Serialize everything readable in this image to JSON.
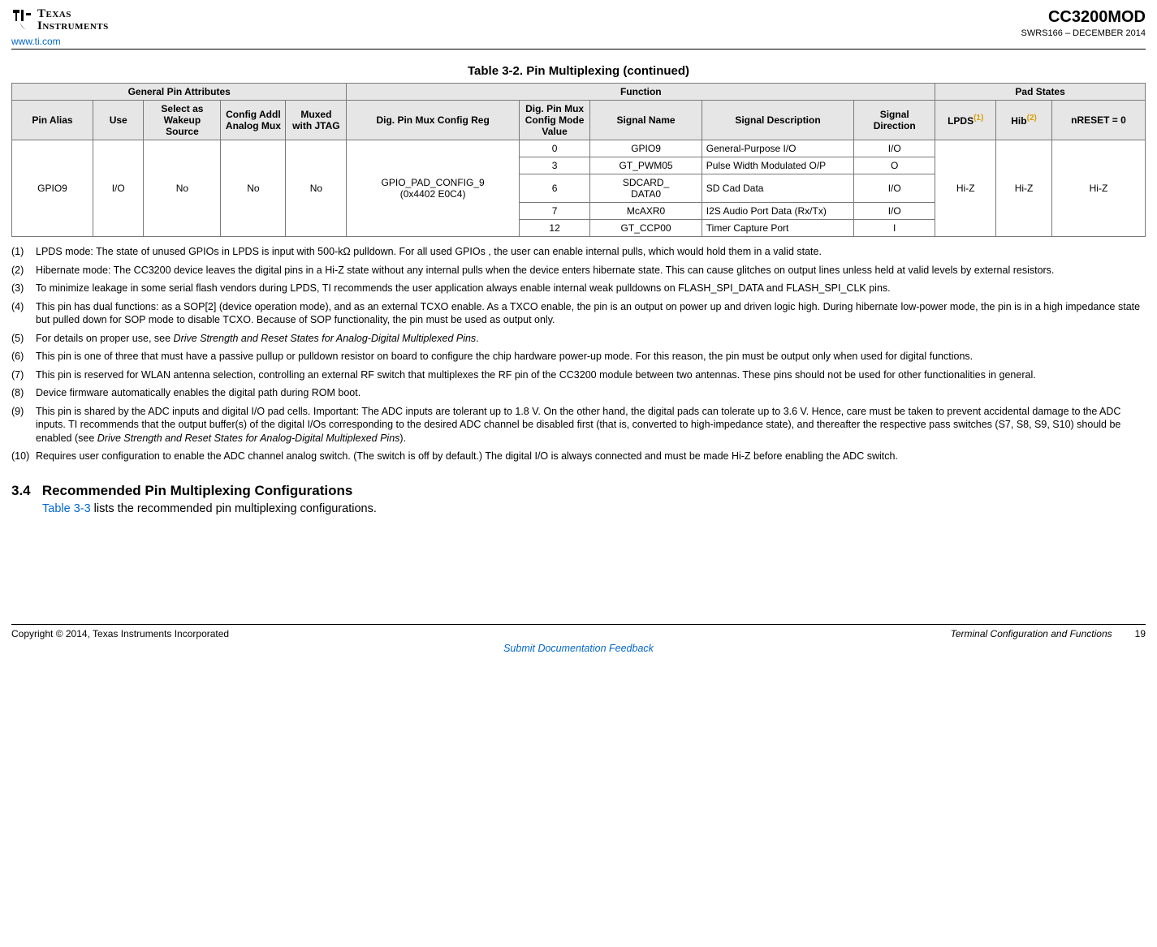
{
  "header": {
    "logo_line1": "Texas",
    "logo_line2": "Instruments",
    "product_code": "CC3200MOD",
    "doc_id": "SWRS166 – DECEMBER 2014",
    "site_url": "www.ti.com"
  },
  "table": {
    "caption": "Table 3-2. Pin Multiplexing (continued)",
    "group_headers": {
      "general": "General Pin Attributes",
      "function": "Function",
      "pad_states": "Pad States"
    },
    "col_headers": {
      "pin_alias": "Pin Alias",
      "use": "Use",
      "select_wakeup": "Select as Wakeup Source",
      "config_analog": "Config Addl Analog Mux",
      "muxed_jtag": "Muxed with JTAG",
      "dig_reg": "Dig. Pin Mux Config Reg",
      "dig_mode_val": "Dig. Pin Mux Config Mode Value",
      "signal_name": "Signal Name",
      "signal_desc": "Signal Description",
      "signal_dir": "Signal Direction",
      "lpds_label": "LPDS",
      "lpds_ref": "(1)",
      "hib_label": "Hib",
      "hib_ref": "(2)",
      "nreset": "nRESET = 0"
    },
    "shared": {
      "pin_alias": "GPIO9",
      "use": "I/O",
      "select_wakeup": "No",
      "config_analog": "No",
      "muxed_jtag": "No",
      "dig_reg_line1": "GPIO_PAD_CONFIG_9",
      "dig_reg_line2": "(0x4402 E0C4)",
      "lpds": "Hi-Z",
      "hib": "Hi-Z",
      "nreset": "Hi-Z"
    },
    "rows": [
      {
        "mode": "0",
        "name": "GPIO9",
        "name2": "",
        "desc": "General-Purpose I/O",
        "dir": "I/O"
      },
      {
        "mode": "3",
        "name": "GT_PWM05",
        "name2": "",
        "desc": "Pulse Width Modulated O/P",
        "dir": "O"
      },
      {
        "mode": "6",
        "name": "SDCARD_",
        "name2": "DATA0",
        "desc": "SD Cad Data",
        "dir": "I/O"
      },
      {
        "mode": "7",
        "name": "McAXR0",
        "name2": "",
        "desc": "I2S Audio Port Data (Rx/Tx)",
        "dir": "I/O"
      },
      {
        "mode": "12",
        "name": "GT_CCP00",
        "name2": "",
        "desc": "Timer Capture Port",
        "dir": "I"
      }
    ]
  },
  "notes": [
    {
      "n": "(1)",
      "text": "LPDS mode: The state of unused GPIOs in LPDS is input with 500-kΩ pulldown. For all used GPIOs , the user can enable internal pulls, which would hold them in a valid state."
    },
    {
      "n": "(2)",
      "text": "Hibernate mode: The CC3200 device leaves the digital pins in a Hi-Z state without any internal pulls when the device enters hibernate state. This can cause glitches on output lines unless held at valid levels by external resistors."
    },
    {
      "n": "(3)",
      "text": "To minimize leakage in some serial flash vendors during LPDS, TI recommends the user application always enable internal weak pulldowns on FLASH_SPI_DATA and FLASH_SPI_CLK pins."
    },
    {
      "n": "(4)",
      "text": "This pin has dual functions: as a SOP[2] (device operation mode), and as an external TCXO enable. As a TXCO enable, the pin is an output on power up and driven logic high. During hibernate low-power mode, the pin is in a high impedance state but pulled down for SOP mode to disable TCXO. Because of SOP functionality, the pin must be used as output only."
    },
    {
      "n": "(5)",
      "text_pre": "For details on proper use, see ",
      "em": "Drive Strength and Reset States for Analog-Digital Multiplexed Pins",
      "text_post": "."
    },
    {
      "n": "(6)",
      "text": "This pin is one of three that must have a passive pullup or pulldown resistor on board to configure the chip hardware power-up mode. For this reason, the pin must be output only when used for digital functions."
    },
    {
      "n": "(7)",
      "text": "This pin is reserved for WLAN antenna selection, controlling an external RF switch that multiplexes the RF pin of the CC3200 module between two antennas. These pins should not be used for other functionalities in general."
    },
    {
      "n": "(8)",
      "text": "Device firmware automatically enables the digital path during ROM boot."
    },
    {
      "n": "(9)",
      "text_pre": "This pin is shared by the ADC inputs and digital I/O pad cells. Important: The ADC inputs are tolerant up to 1.8 V. On the other hand, the digital pads can tolerate up to 3.6 V. Hence, care must be taken to prevent accidental damage to the ADC inputs. TI recommends that the output buffer(s) of the digital I/Os corresponding to the desired ADC channel be disabled first (that is, converted to high-impedance state), and thereafter the respective pass switches (S7, S8, S9, S10) should be enabled (see ",
      "em": "Drive Strength and Reset States for Analog-Digital Multiplexed Pins",
      "text_post": ")."
    },
    {
      "n": "(10)",
      "text": "Requires user configuration to enable the ADC channel analog switch. (The switch is off by default.) The digital I/O is always connected and must be made Hi-Z before enabling the ADC switch."
    }
  ],
  "section": {
    "number": "3.4",
    "title": "Recommended Pin Multiplexing Configurations",
    "body_link": "Table 3-3",
    "body_rest": " lists the recommended pin multiplexing configurations."
  },
  "footer": {
    "copyright": "Copyright © 2014, Texas Instruments Incorporated",
    "section_title": "Terminal Configuration and Functions",
    "page_num": "19",
    "submit": "Submit Documentation Feedback"
  }
}
